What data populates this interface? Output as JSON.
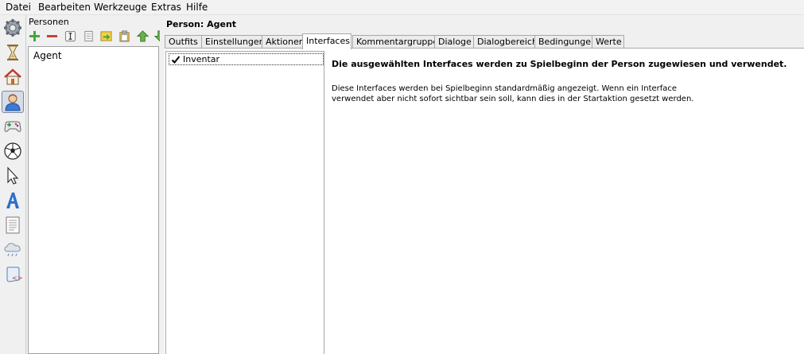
{
  "menubar": {
    "items": [
      "Datei",
      "Bearbeiten",
      "Werkzeuge",
      "Extras",
      "Hilfe"
    ]
  },
  "toolstrip": {
    "icons": [
      "settings-gear-icon",
      "hourglass-icon",
      "house-icon",
      "person-icon",
      "gamepad-icon",
      "soccer-ball-icon",
      "cursor-arrow-icon",
      "text-font-icon",
      "document-page-icon",
      "cloud-weather-icon",
      "script-scroll-icon"
    ],
    "selected_index": 3
  },
  "persons_panel": {
    "title": "Personen",
    "toolbar": [
      "add-icon",
      "remove-icon",
      "rename-icon",
      "copy-icon",
      "import-icon",
      "paste-icon",
      "move-up-icon",
      "move-down-icon"
    ],
    "items": [
      "Agent"
    ]
  },
  "detail": {
    "title": "Person: Agent",
    "tabs": [
      "Outfits",
      "Einstellungen",
      "Aktionen",
      "Interfaces",
      "Kommentargruppen",
      "Dialoge",
      "Dialogbereich",
      "Bedingungen",
      "Werte"
    ],
    "active_tab": "Interfaces",
    "interfaces": [
      {
        "label": "Inventar",
        "checked": true
      }
    ],
    "help_heading": "Die ausgewählten Interfaces werden zu Spielbeginn der Person zugewiesen und verwendet.",
    "help_text": "Diese Interfaces werden bei Spielbeginn standardmäßig angezeigt. Wenn ein Interface\nverwendet aber nicht sofort sichtbar sein soll, kann dies in der Startaktion gesetzt werden."
  }
}
